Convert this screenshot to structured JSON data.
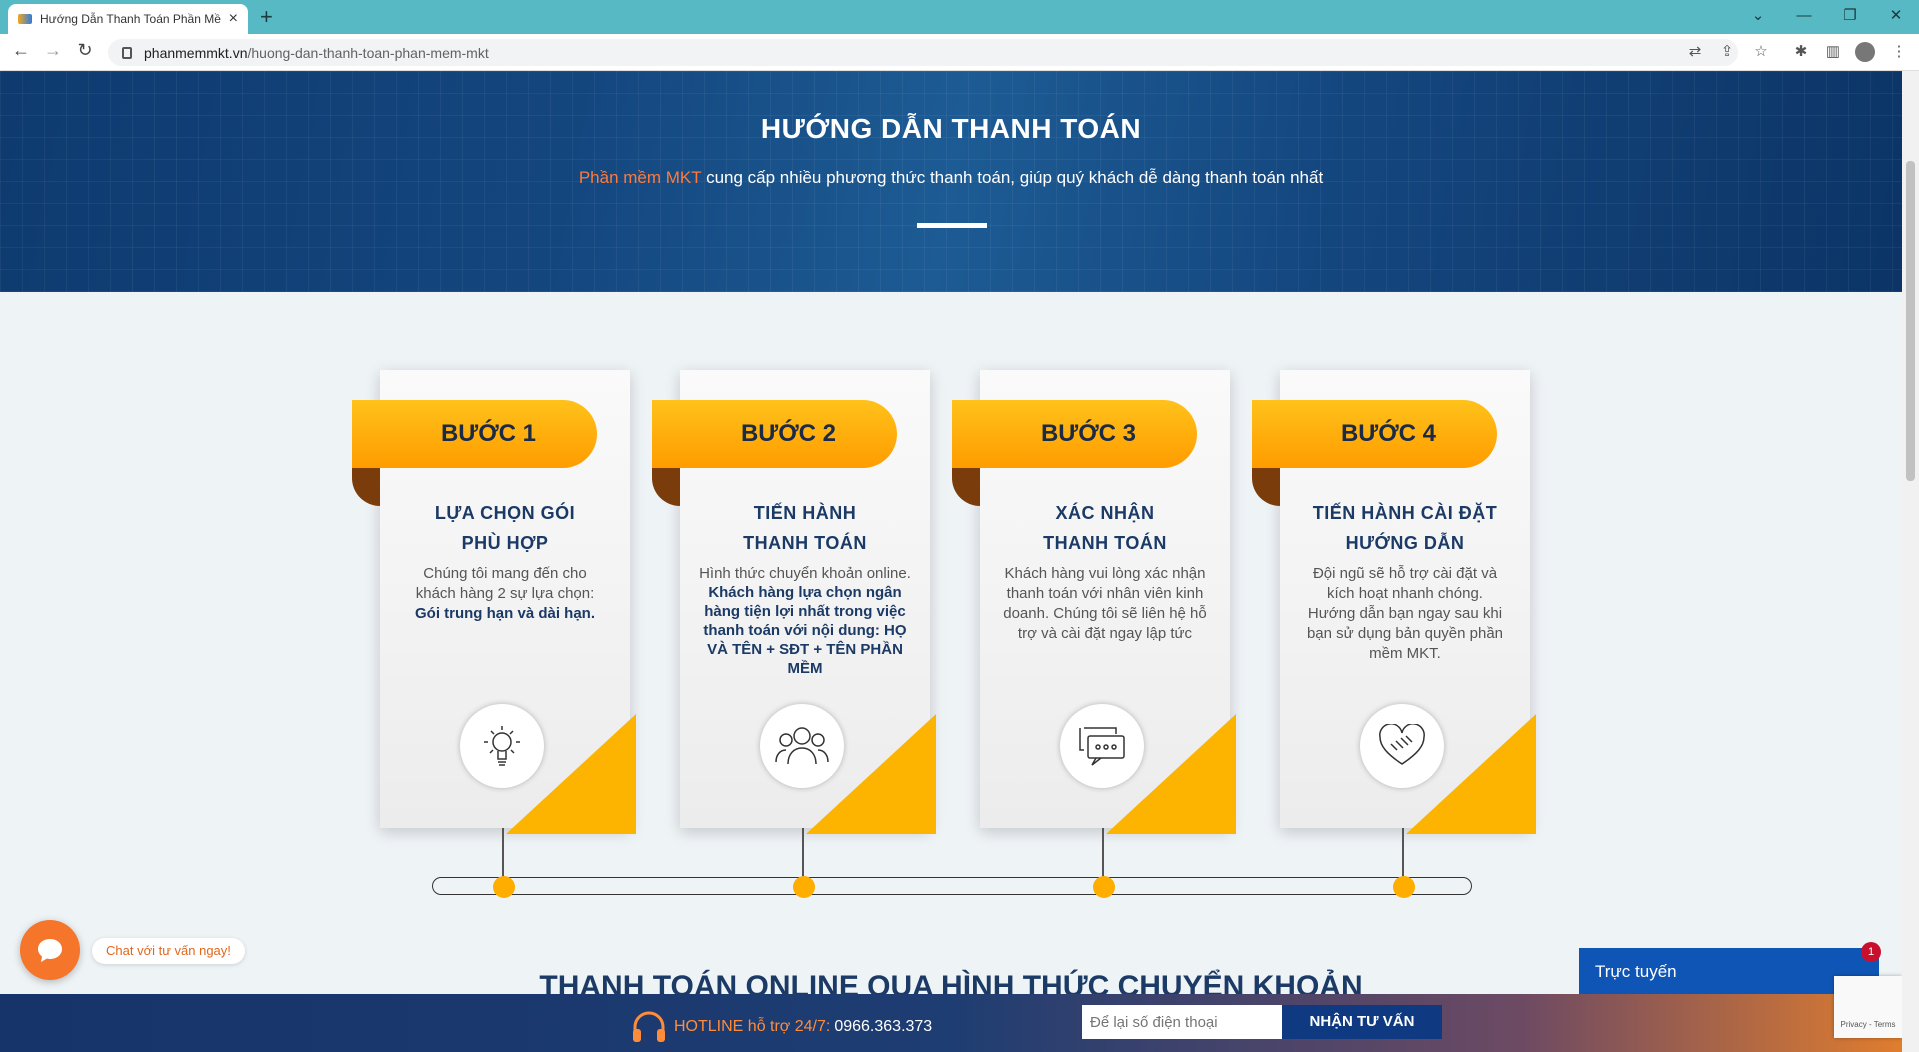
{
  "browser": {
    "tab_title": "Hướng Dẫn Thanh Toán Phần Mề",
    "new_tab": "+",
    "url_domain": "phanmemmkt.vn",
    "url_path": "/huong-dan-thanh-toan-phan-mem-mkt"
  },
  "hero": {
    "title": "HƯỚNG DẪN THANH TOÁN",
    "subtitle_highlight": "Phần mềm MKT",
    "subtitle_rest": " cung cấp nhiều phương thức thanh toán, giúp quý khách dễ dàng thanh toán nhất"
  },
  "steps": [
    {
      "label": "BƯỚC 1",
      "title1": "LỰA CHỌN GÓI",
      "title2": "PHÙ HỢP",
      "desc": "Chúng tôi mang đến cho khách hàng 2 sự lựa chọn:",
      "desc_bold": "Gói trung hạn và dài hạn.",
      "icon": "lightbulb-icon"
    },
    {
      "label": "BƯỚC 2",
      "title1": "TIẾN HÀNH",
      "title2": "THANH TOÁN",
      "desc": "Hình thức chuyển khoản online. ",
      "desc_bold": "Khách hàng lựa chọn ngân hàng tiện lợi nhất trong việc thanh toán với nội dung: HỌ VÀ TÊN + SĐT + TÊN PHẦN MỀM",
      "icon": "people-icon"
    },
    {
      "label": "BƯỚC 3",
      "title1": "XÁC NHẬN",
      "title2": "THANH TOÁN",
      "desc": "Khách hàng vui lòng xác nhận thanh toán với nhân viên kinh doanh. Chúng tôi sẽ liên hệ hỗ trợ và cài đặt ngay lập tức",
      "desc_bold": "",
      "icon": "chat-bubbles-icon"
    },
    {
      "label": "BƯỚC 4",
      "title1": "TIẾN HÀNH CÀI ĐẶT",
      "title2": "HƯỚNG DẪN",
      "desc": "Đội ngũ sẽ hỗ trợ cài đặt và kích hoạt nhanh chóng. Hướng dẫn bạn ngay sau khi bạn sử dụng bản quyền phần mềm MKT.",
      "desc_bold": "",
      "icon": "handshake-icon"
    }
  ],
  "chat": {
    "label": "Chat với tư vấn ngay!"
  },
  "section2_title": "THANH TOÁN ONLINE QUA HÌNH THỨC CHUYỂN KHOẢN",
  "live": {
    "label": "Trực tuyến",
    "badge": "1"
  },
  "footer": {
    "hotline_label": "HOTLINE hỗ trợ 24/7:",
    "hotline_number": "0966.363.373",
    "phone_placeholder": "Để lại số điện thoại",
    "cta": "NHẬN TƯ VẤN"
  },
  "recaptcha": {
    "text": "Privacy - Terms"
  }
}
